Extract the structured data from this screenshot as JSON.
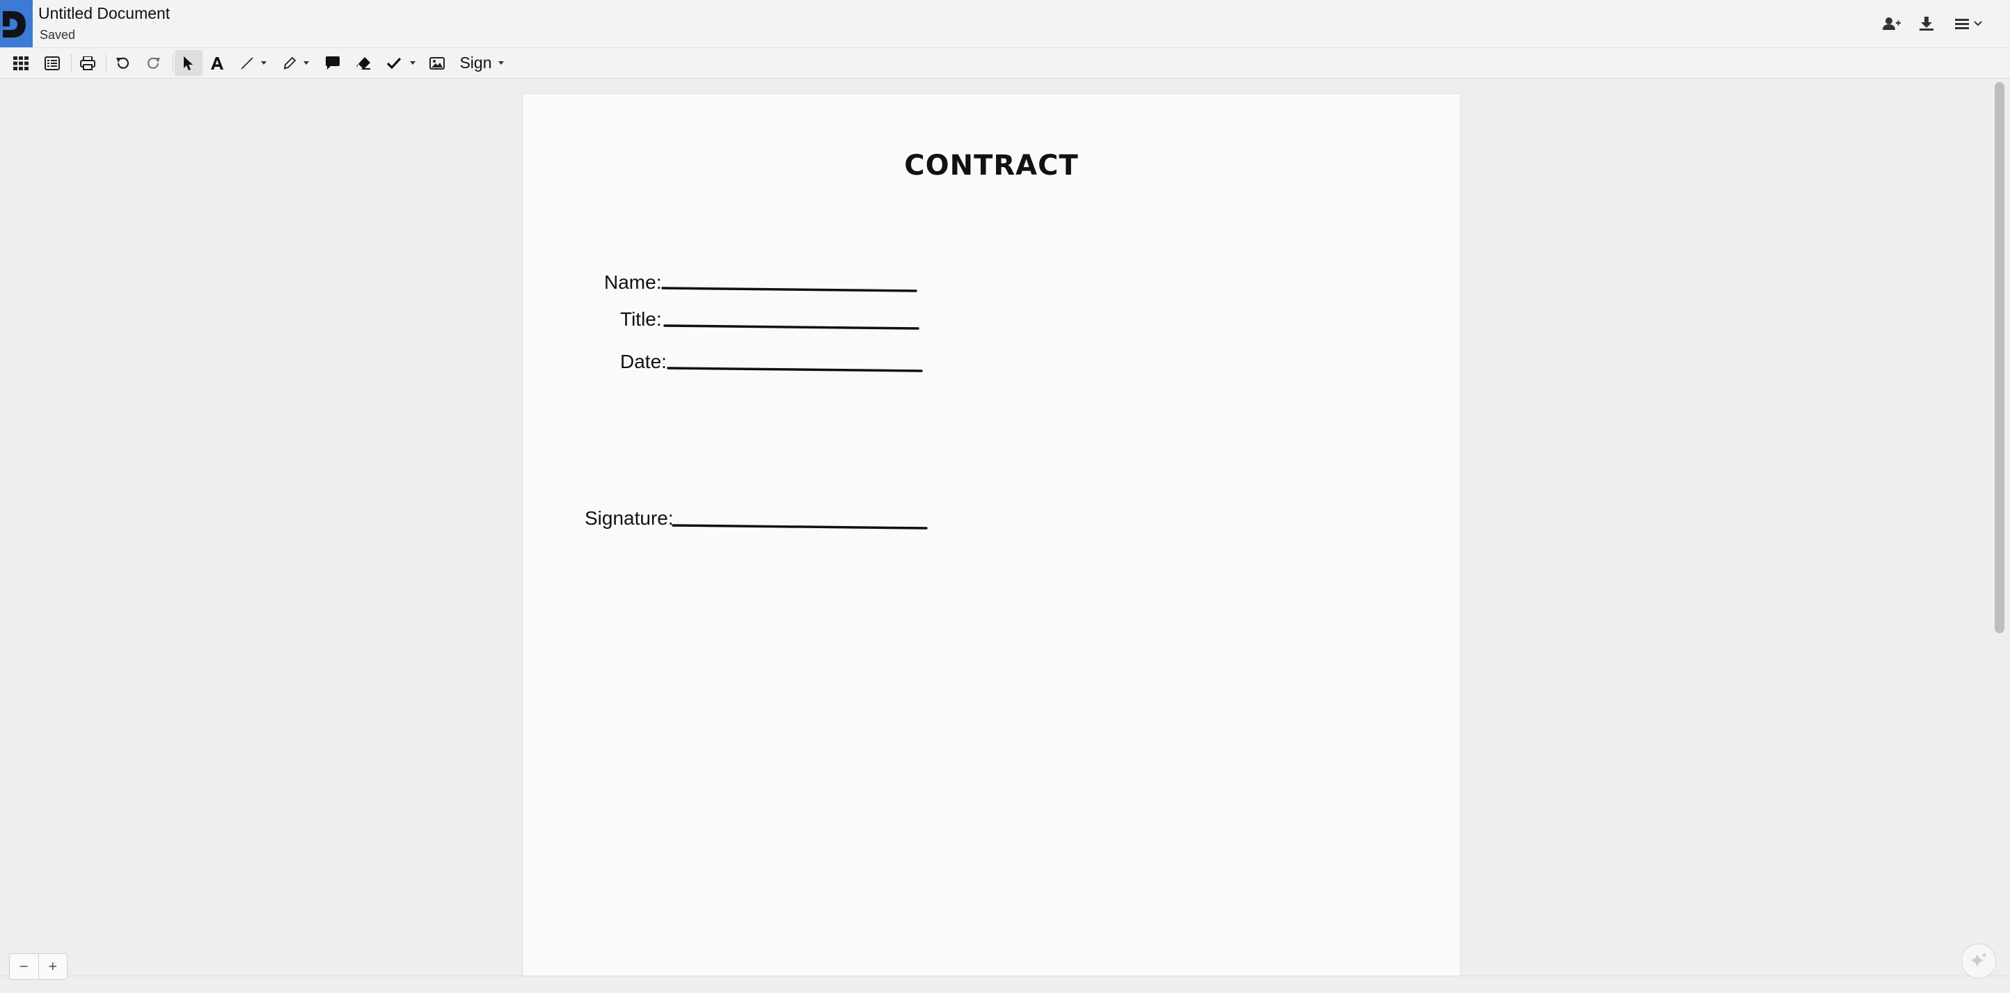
{
  "app": {
    "document_title": "Untitled Document",
    "save_status": "Saved"
  },
  "header_actions": {
    "share_icon": "person-add-icon",
    "download_icon": "download-icon",
    "menu_icon": "hamburger-menu-icon"
  },
  "toolbar": {
    "sign_label": "Sign",
    "icons": [
      "grid-view-icon",
      "list-view-icon",
      "print-icon",
      "undo-icon",
      "redo-icon",
      "pointer-icon",
      "text-icon",
      "line-icon",
      "pen-icon",
      "comment-icon",
      "eraser-icon",
      "checkmark-icon",
      "image-icon"
    ]
  },
  "document": {
    "heading": "CONTRACT",
    "fields": {
      "name_label": "Name:",
      "title_label": "Title:",
      "date_label": "Date:",
      "signature_label": "Signature:"
    }
  },
  "zoom": {
    "out_label": "−",
    "in_label": "+"
  },
  "colors": {
    "accent": "#3d7ad6",
    "toolbar_bg": "#f3f3f4",
    "workspace_bg": "#eeeef0",
    "page_bg": "#fafafa"
  }
}
